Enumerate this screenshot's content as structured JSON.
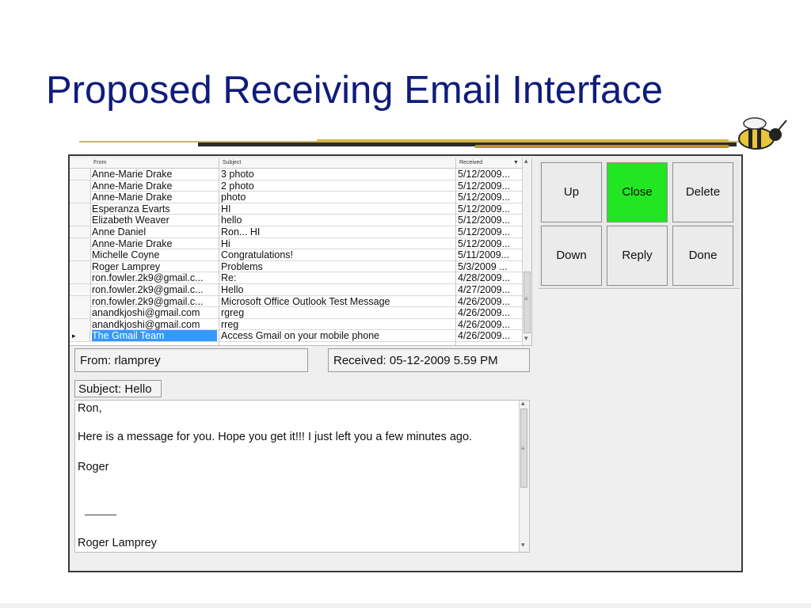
{
  "slide": {
    "title": "Proposed Receiving Email Interface"
  },
  "grid": {
    "columns": [
      "From",
      "Subject",
      "Received"
    ],
    "rows": [
      {
        "from": "Anne-Marie Drake",
        "subject": "3 photo",
        "received": "5/12/2009..."
      },
      {
        "from": "Anne-Marie Drake",
        "subject": "2 photo",
        "received": "5/12/2009..."
      },
      {
        "from": "Anne-Marie Drake",
        "subject": "photo",
        "received": "5/12/2009..."
      },
      {
        "from": "Esperanza Evarts",
        "subject": "HI",
        "received": "5/12/2009..."
      },
      {
        "from": "Elizabeth Weaver",
        "subject": "hello",
        "received": "5/12/2009..."
      },
      {
        "from": "Anne Daniel",
        "subject": "Ron... HI",
        "received": "5/12/2009..."
      },
      {
        "from": "Anne-Marie Drake",
        "subject": "Hi",
        "received": "5/12/2009..."
      },
      {
        "from": "Michelle Coyne",
        "subject": "Congratulations!",
        "received": "5/11/2009..."
      },
      {
        "from": "Roger Lamprey",
        "subject": "Problems",
        "received": "5/3/2009 ..."
      },
      {
        "from": "ron.fowler.2k9@gmail.c...",
        "subject": "Re:",
        "received": "4/28/2009..."
      },
      {
        "from": "ron.fowler.2k9@gmail.c...",
        "subject": "Hello",
        "received": "4/27/2009..."
      },
      {
        "from": "ron.fowler.2k9@gmail.c...",
        "subject": "Microsoft Office Outlook Test Message",
        "received": "4/26/2009..."
      },
      {
        "from": "anandkjoshi@gmail.com",
        "subject": "rgreg",
        "received": "4/26/2009..."
      },
      {
        "from": "anandkjoshi@gmail.com",
        "subject": "rreg",
        "received": "4/26/2009..."
      },
      {
        "from": "The Gmail Team",
        "subject": "Access Gmail on your mobile phone",
        "received": "4/26/2009..."
      }
    ],
    "selected_index": 14,
    "row_marker": "▸",
    "sort_glyph": "▼",
    "scroll_up_glyph": "▴",
    "scroll_down_glyph": "▾",
    "grip_glyph": "≡"
  },
  "detail": {
    "from": "From: rlamprey",
    "received": "Received: 05-12-2009 5.59 PM",
    "subject": "Subject: Hello",
    "body_lines": [
      "Ron,",
      "Here is a message for you. Hope you get it!!! I just left you a few minutes ago.",
      "Roger",
      "Roger Lamprey"
    ]
  },
  "buttons": {
    "up": "Up",
    "close": "Close",
    "delete": "Delete",
    "down": "Down",
    "reply": "Reply",
    "done": "Done"
  },
  "colors": {
    "title": "#0f1c7a",
    "close_button": "#22e622",
    "selection": "#3399ff"
  }
}
